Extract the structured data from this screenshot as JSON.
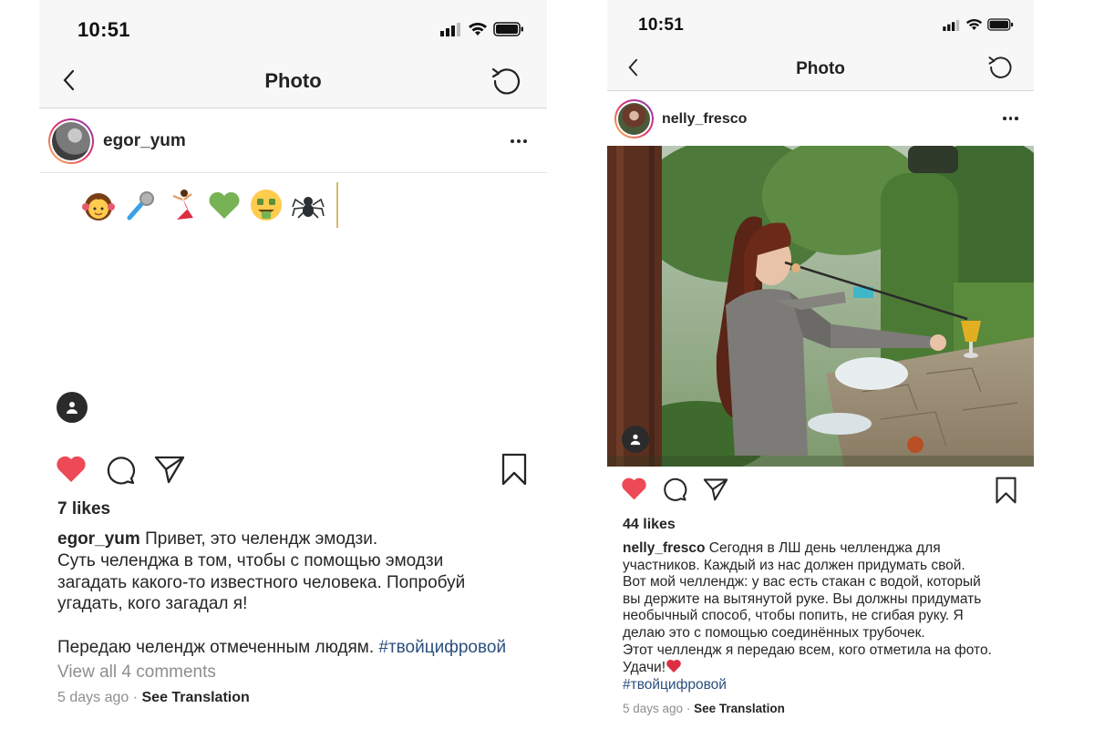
{
  "left": {
    "status": {
      "time": "10:51"
    },
    "nav": {
      "title": "Photo"
    },
    "post": {
      "username": "egor_yum",
      "emojis": [
        "girl-emoji",
        "microphone-emoji",
        "dancer-emoji",
        "green-heart-emoji",
        "money-mouth-emoji",
        "spider-emoji"
      ],
      "likes": "7 likes",
      "caption_user": "egor_yum",
      "caption_line1": "Привет, это челендж эмодзи.",
      "caption_line2": "Суть челенджа в том, чтобы с помощью эмодзи",
      "caption_line3": "загадать какого-то известного человека. Попробуй",
      "caption_line4": "угадать, кого загадал я!",
      "caption_line5": "Передаю челендж отмеченным людям.",
      "hashtag": "#твойцифровой",
      "view_comments": "View all 4 comments",
      "time_ago": "5 days ago",
      "see_translation": "See Translation"
    }
  },
  "right": {
    "status": {
      "time": "10:51"
    },
    "nav": {
      "title": "Photo"
    },
    "post": {
      "username": "nelly_fresco",
      "likes": "44 likes",
      "caption_user": "nelly_fresco",
      "caption_line1": "Сегодня в ЛШ день челленджа для",
      "caption_line2": "участников. Каждый из нас должен придумать свой.",
      "caption_line3": "Вот мой челлендж: у вас есть стакан с водой, который",
      "caption_line4": "вы держите на вытянутой руке. Вы должны придумать",
      "caption_line5": "необычный способ, чтобы попить, не сгибая руку. Я",
      "caption_line6": "делаю это с помощью соединённых трубочек.",
      "caption_line7": "Этот челлендж я передаю всем, кого отметила на фото.",
      "caption_line8": "Удачи!",
      "hashtag": "#твойцифровой",
      "time_ago": "5 days ago",
      "see_translation": "See Translation"
    }
  },
  "colors": {
    "like_red": "#ed4956",
    "hashtag_blue": "#2b4f7d",
    "meta_gray": "#8e8e8e"
  }
}
